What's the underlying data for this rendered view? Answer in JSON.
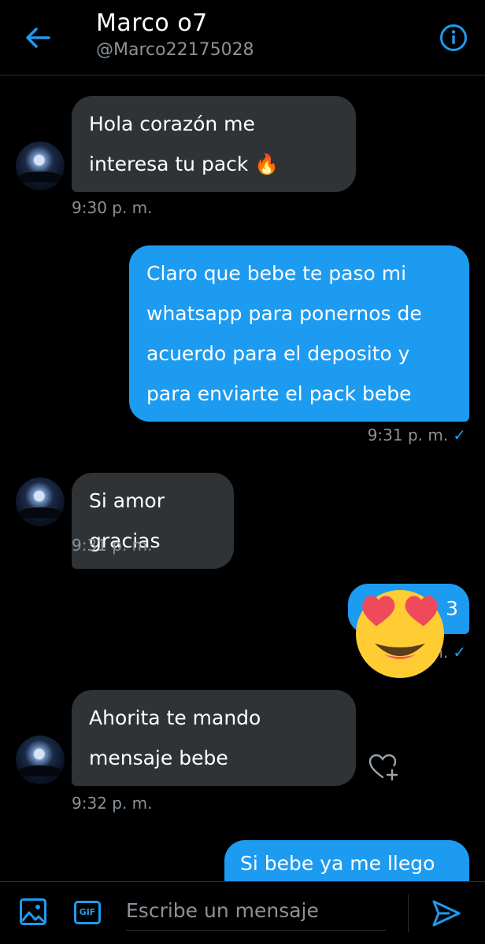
{
  "header": {
    "title": "Marco o7",
    "handle": "@Marco22175028"
  },
  "messages": [
    {
      "direction": "in",
      "text": "Hola corazón me interesa tu pack 🔥",
      "time": "9:30 p. m."
    },
    {
      "direction": "out",
      "text": "Claro que bebe te paso mi whatsapp para ponernos de acuerdo para el deposito y para enviarte el pack bebe",
      "time": "9:31 p. m.",
      "status": "✓"
    },
    {
      "direction": "in",
      "text": "Si amor gracias",
      "time": "9:31 p. m."
    },
    {
      "direction": "out",
      "text": "3",
      "time": "m.",
      "status": "✓"
    },
    {
      "direction": "in",
      "text": "Ahorita te mando mensaje bebe",
      "time": "9:32 p. m."
    },
    {
      "direction": "out",
      "text": "Si bebe ya me llego ❤️"
    }
  ],
  "composer": {
    "placeholder": "Escribe un mensaje",
    "gif_label": "GIF"
  },
  "colors": {
    "accent": "#1d9bf0",
    "incoming_bubble": "#2f3336",
    "background": "#000000",
    "muted_text": "#8a9299"
  },
  "icons": {
    "back": "arrow-left-icon",
    "info": "info-circle-icon",
    "image": "image-icon",
    "send": "send-icon",
    "heart_add": "heart-plus-icon",
    "overlay_emoji": "heart-eyes-emoji"
  }
}
